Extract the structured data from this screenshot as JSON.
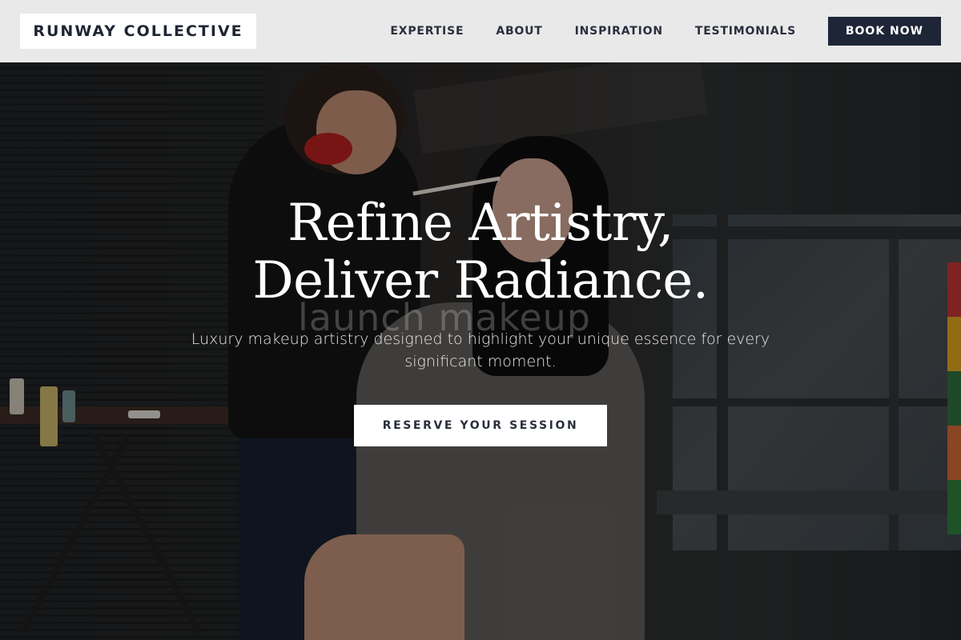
{
  "header": {
    "logo_text": "RUNWAY COLLECTIVE",
    "nav": [
      {
        "label": "EXPERTISE"
      },
      {
        "label": "ABOUT"
      },
      {
        "label": "INSPIRATION"
      },
      {
        "label": "TESTIMONIALS"
      }
    ],
    "book_label": "BOOK NOW"
  },
  "hero": {
    "headline_line1": "Refine Artistry,",
    "headline_line2": "Deliver Radiance.",
    "background_watermark": "launch makeup",
    "subtext": "Luxury makeup artistry designed to highlight your unique essence for every significant moment.",
    "cta_label": "RESERVE YOUR SESSION"
  },
  "colors": {
    "header_bg": "#e9e9e9",
    "navy": "#1e2537",
    "white": "#ffffff"
  }
}
